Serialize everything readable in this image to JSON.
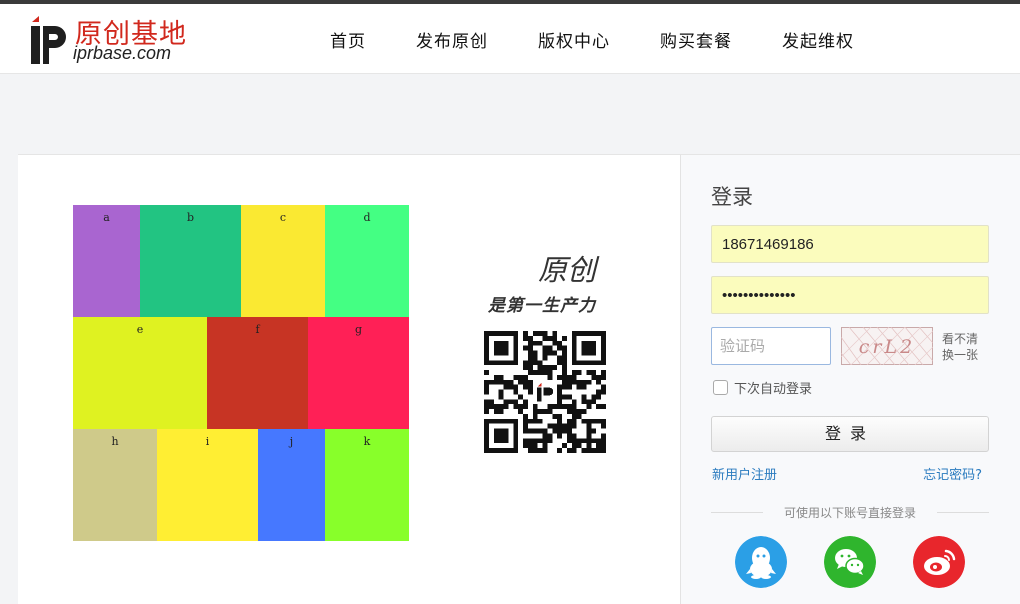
{
  "logo": {
    "cn": "原创基地",
    "en": "iprbase.com"
  },
  "nav": [
    "首页",
    "发布原创",
    "版权中心",
    "购买套餐",
    "发起维权"
  ],
  "grid": [
    {
      "label": "a",
      "color": "#a965d0"
    },
    {
      "label": "b",
      "color": "#22c482"
    },
    {
      "label": "c",
      "color": "#fae932"
    },
    {
      "label": "d",
      "color": "#44ff83"
    },
    {
      "label": "e",
      "color": "#dff221"
    },
    {
      "label": "f",
      "color": "#c73424"
    },
    {
      "label": "g",
      "color": "#ff2056"
    },
    {
      "label": "h",
      "color": "#cfca8a"
    },
    {
      "label": "i",
      "color": "#ffee33"
    },
    {
      "label": "j",
      "color": "#4678ff"
    },
    {
      "label": "k",
      "color": "#88ff2a"
    }
  ],
  "slogan": {
    "line1": "原创",
    "line2": "是第一生产力"
  },
  "login": {
    "title": "登录",
    "username": "18671469186",
    "password": "••••••••••••••",
    "captcha_placeholder": "验证码",
    "captcha_text": "crL2",
    "refresh_line1": "看不清",
    "refresh_line2": "换一张",
    "remember_label": "下次自动登录",
    "submit_label": "登录",
    "register_link": "新用户注册",
    "forgot_link": "忘记密码?",
    "third_party_label": "可使用以下账号直接登录"
  },
  "colors": {
    "qq": "#2b9fe6",
    "wechat": "#2fb52d",
    "weibo": "#e8262c",
    "link": "#2a7bbf",
    "brand_red": "#d1281d"
  }
}
